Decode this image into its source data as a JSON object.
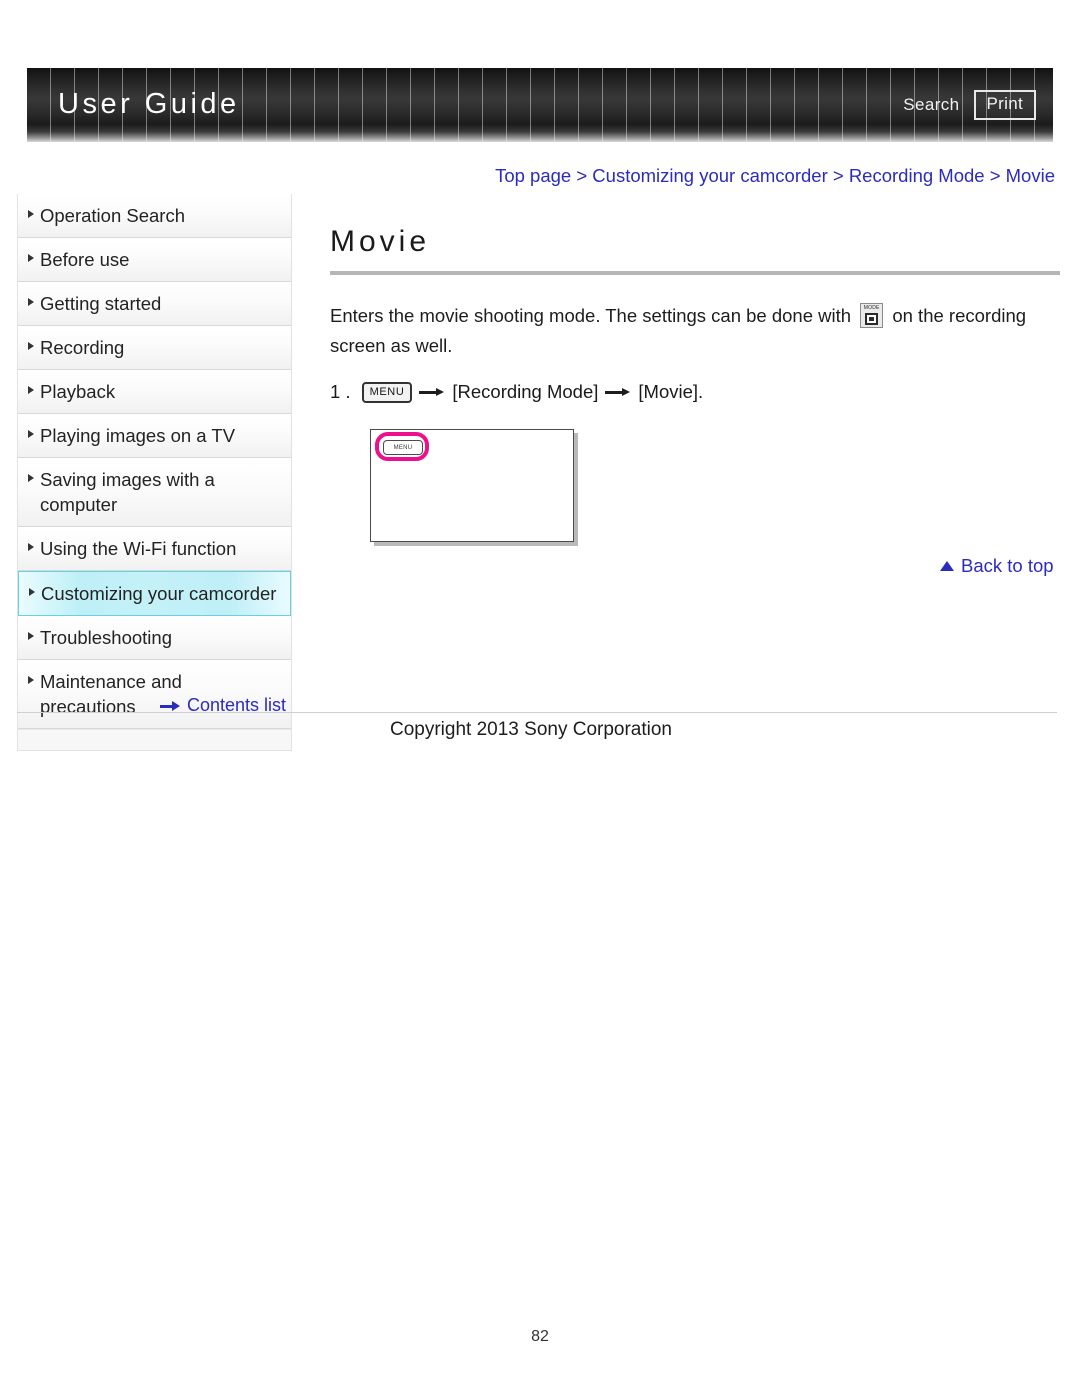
{
  "header": {
    "title": "User Guide",
    "search_label": "Search",
    "print_label": "Print"
  },
  "breadcrumb": {
    "text": "Top page > Customizing your camcorder > Recording Mode > Movie"
  },
  "sidebar": {
    "items": [
      {
        "label": "Operation Search",
        "active": false
      },
      {
        "label": "Before use",
        "active": false
      },
      {
        "label": "Getting started",
        "active": false
      },
      {
        "label": "Recording",
        "active": false
      },
      {
        "label": "Playback",
        "active": false
      },
      {
        "label": "Playing images on a TV",
        "active": false
      },
      {
        "label": "Saving images with a computer",
        "active": false
      },
      {
        "label": "Using the Wi-Fi function",
        "active": false
      },
      {
        "label": "Customizing your camcorder",
        "active": true
      },
      {
        "label": "Troubleshooting",
        "active": false
      },
      {
        "label": "Maintenance and precautions",
        "active": false
      }
    ],
    "contents_list_label": "Contents list"
  },
  "main": {
    "page_title": "Movie",
    "intro_part1": "Enters the movie shooting mode. The settings can be done with",
    "mode_icon_label": "MODE",
    "intro_part2": "on the recording screen as well.",
    "step_number": "1 .",
    "menu_icon_label": "MENU",
    "step_target1": "[Recording Mode]",
    "step_target2": "[Movie].",
    "figure": {
      "menu_button_label": "MENU"
    },
    "back_to_top_label": "Back to top"
  },
  "footer": {
    "copyright": "Copyright 2013 Sony Corporation",
    "page_number": "82"
  },
  "colors": {
    "link_blue": "#2b2bbf",
    "highlight_pink": "#ec0f8e",
    "active_cyan_border": "#63d2e3",
    "rule_gray": "#b6b6b6"
  }
}
